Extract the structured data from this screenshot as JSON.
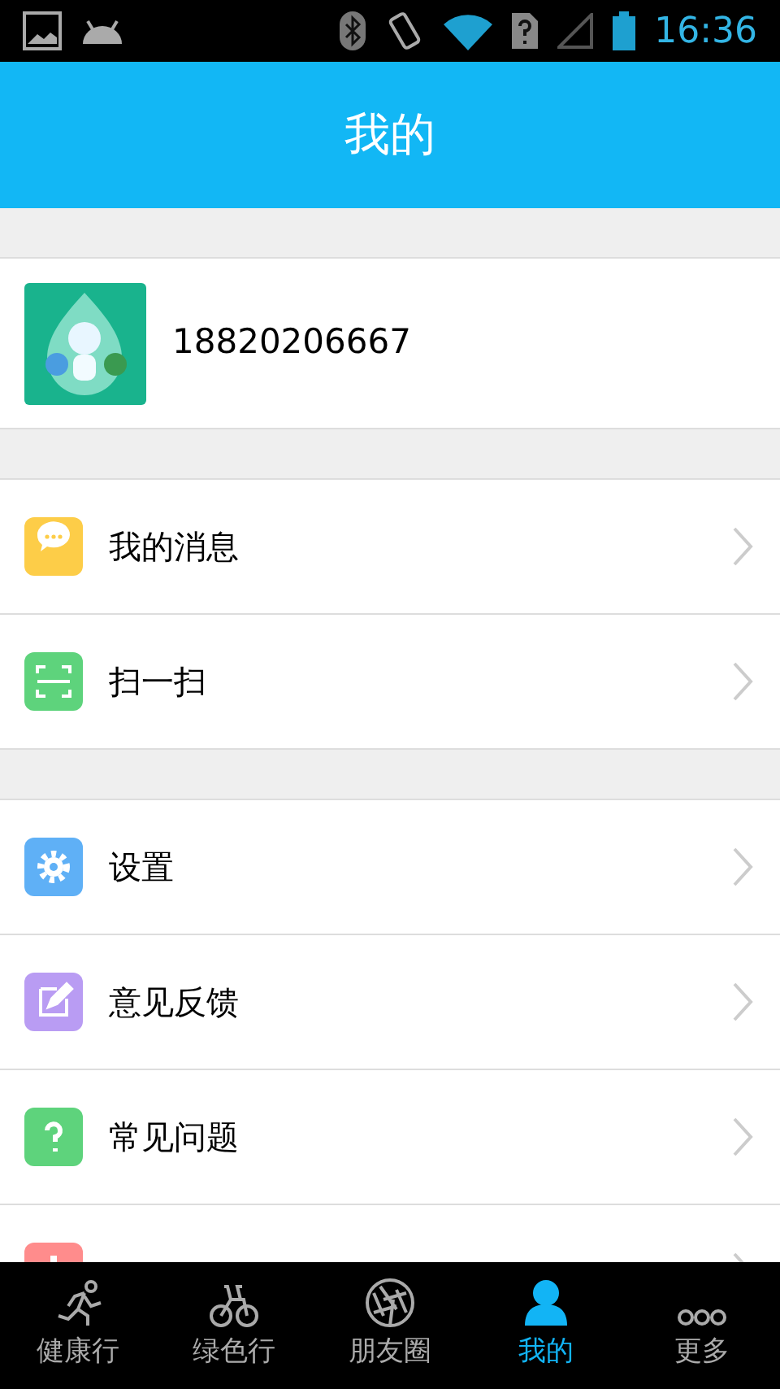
{
  "status_bar": {
    "time": "16:36"
  },
  "header": {
    "title": "我的"
  },
  "profile": {
    "phone": "18820206667"
  },
  "groups": [
    {
      "items": [
        {
          "label": "我的消息",
          "kind": "message",
          "color": "#fdcd48"
        },
        {
          "label": "扫一扫",
          "kind": "scan",
          "color": "#5ed37c"
        }
      ]
    },
    {
      "items": [
        {
          "label": "设置",
          "kind": "gear",
          "color": "#5fb0f6"
        },
        {
          "label": "意见反馈",
          "kind": "pencil",
          "color": "#b99cf3"
        },
        {
          "label": "常见问题",
          "kind": "question",
          "color": "#5ed37c"
        },
        {
          "kind": "info",
          "color": "#ff8c8c"
        }
      ]
    }
  ],
  "tabs": [
    {
      "label": "健康行",
      "kind": "runner",
      "selected": false
    },
    {
      "label": "绿色行",
      "kind": "bike",
      "selected": false
    },
    {
      "label": "朋友圈",
      "kind": "aperture",
      "selected": false
    },
    {
      "label": "我的",
      "kind": "person",
      "selected": true
    },
    {
      "label": "更多",
      "kind": "dots",
      "selected": false
    }
  ]
}
